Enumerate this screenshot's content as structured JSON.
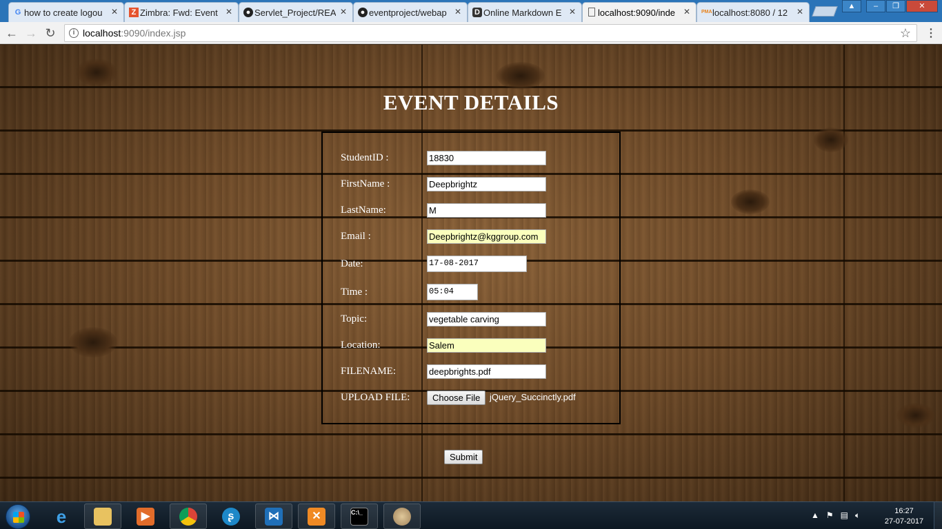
{
  "browser": {
    "tabs": [
      {
        "title": "how to create logou",
        "favicon": "G"
      },
      {
        "title": "Zimbra: Fwd: Event",
        "favicon": "Z"
      },
      {
        "title": "Servlet_Project/REA",
        "favicon": "github-icon"
      },
      {
        "title": "eventproject/webap",
        "favicon": "github-icon"
      },
      {
        "title": "Online Markdown E",
        "favicon": "D"
      },
      {
        "title": "localhost:9090/inde",
        "favicon": "page-icon"
      },
      {
        "title": "localhost:8080 / 12",
        "favicon": "PMA"
      }
    ],
    "active_tab_index": 5,
    "url_host": "localhost",
    "url_rest": ":9090/index.jsp"
  },
  "page": {
    "title": "EVENT DETAILS",
    "fields": [
      {
        "label": "StudentID :",
        "value": "18830"
      },
      {
        "label": "FirstName :",
        "value": "Deepbrightz"
      },
      {
        "label": "LastName:",
        "value": "M"
      },
      {
        "label": "Email :",
        "value": "Deepbrightz@kggroup.com"
      },
      {
        "label": "Date:",
        "value": "17-08-2017"
      },
      {
        "label": "Time :",
        "value": "05:04"
      },
      {
        "label": "Topic:",
        "value": "vegetable carving"
      },
      {
        "label": "Location:",
        "value": "Salem"
      },
      {
        "label": "FILENAME:",
        "value": "deepbrights.pdf"
      },
      {
        "label": "UPLOAD FILE:",
        "button": "Choose File",
        "file": "jQuery_Succinctly.pdf"
      }
    ],
    "submit_label": "Submit",
    "colors": {
      "autofill": "#faffbd",
      "title": "#ffffff"
    }
  },
  "taskbar": {
    "time": "16:27",
    "date": "27-07-2017"
  }
}
